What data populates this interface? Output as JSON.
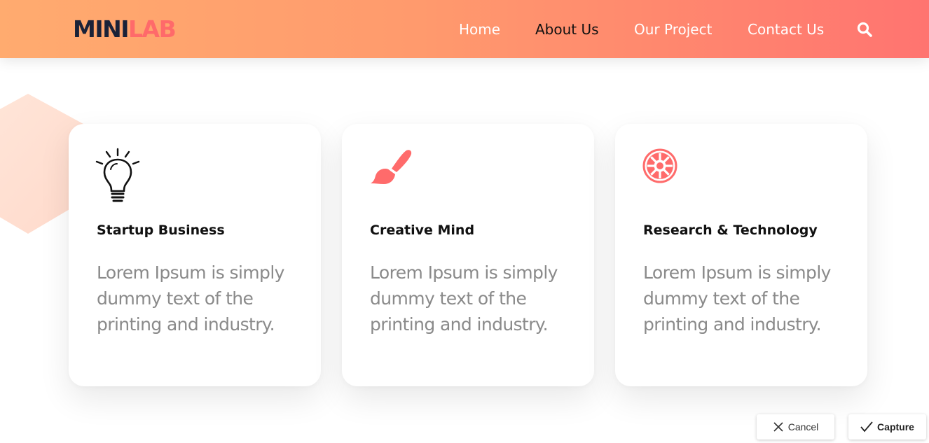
{
  "header": {
    "logo_part1": "MINI",
    "logo_part2": "LAB",
    "nav": [
      {
        "label": "Home"
      },
      {
        "label": "About Us"
      },
      {
        "label": "Our Project"
      },
      {
        "label": "Contact Us"
      }
    ],
    "search_icon": "search-icon"
  },
  "cards": [
    {
      "icon": "lightbulb-icon",
      "title": "Startup Business",
      "text": "Lorem Ipsum is simply dummy text of the printing and industry."
    },
    {
      "icon": "paintbrush-icon",
      "title": "Creative Mind",
      "text": "Lorem Ipsum is simply dummy text of the printing and industry."
    },
    {
      "icon": "empire-icon",
      "title": "Research & Technology",
      "text": "Lorem Ipsum is simply dummy text of the printing and industry."
    }
  ],
  "actions": {
    "cancel_label": "Cancel",
    "capture_label": "Capture"
  },
  "colors": {
    "header_start": "#ffab6f",
    "header_end": "#ff7470",
    "accent": "#ff6a6a",
    "logo_dark": "#1a2238"
  }
}
